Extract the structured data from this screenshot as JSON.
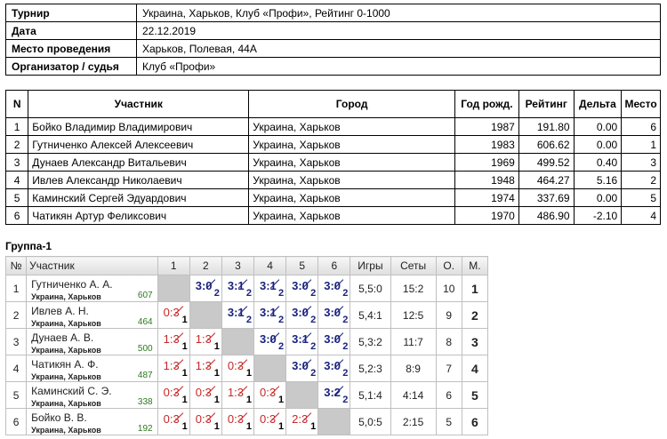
{
  "info": [
    {
      "label": "Турнир",
      "value": "Украина, Харьков, Клуб «Профи», Рейтинг 0-1000"
    },
    {
      "label": "Дата",
      "value": "22.12.2019"
    },
    {
      "label": "Место проведения",
      "value": "Харьков, Полевая, 44А"
    },
    {
      "label": "Организатор / судья",
      "value": "Клуб «Профи»"
    }
  ],
  "main": {
    "headers": {
      "n": "N",
      "player": "Участник",
      "city": "Город",
      "year": "Год рожд.",
      "rating": "Рейтинг",
      "delta": "Дельта",
      "place": "Место"
    },
    "rows": [
      {
        "n": "1",
        "player": "Бойко Владимир Владимирович",
        "city": "Украина, Харьков",
        "year": "1987",
        "rating": "191.80",
        "delta": "0.00",
        "place": "6"
      },
      {
        "n": "2",
        "player": "Гутниченко Алексей Алексеевич",
        "city": "Украина, Харьков",
        "year": "1983",
        "rating": "606.62",
        "delta": "0.00",
        "place": "1"
      },
      {
        "n": "3",
        "player": "Дунаев Александр Витальевич",
        "city": "Украина, Харьков",
        "year": "1969",
        "rating": "499.52",
        "delta": "0.40",
        "place": "3"
      },
      {
        "n": "4",
        "player": "Ивлев Александр Николаевич",
        "city": "Украина, Харьков",
        "year": "1948",
        "rating": "464.27",
        "delta": "5.16",
        "place": "2"
      },
      {
        "n": "5",
        "player": "Каминский Сергей Эдуардович",
        "city": "Украина, Харьков",
        "year": "1974",
        "rating": "337.69",
        "delta": "0.00",
        "place": "5"
      },
      {
        "n": "6",
        "player": "Чатикян Артур Феликсович",
        "city": "Украина, Харьков",
        "year": "1970",
        "rating": "486.90",
        "delta": "-2.10",
        "place": "4"
      }
    ]
  },
  "group": {
    "title": "Группа-1",
    "headers": {
      "n": "№",
      "player": "Участник",
      "c1": "1",
      "c2": "2",
      "c3": "3",
      "c4": "4",
      "c5": "5",
      "c6": "6",
      "games": "Игры",
      "sets": "Сеты",
      "points": "О.",
      "place": "М."
    },
    "rows": [
      {
        "n": "1",
        "name": "Гутниченко А. А.",
        "city": "Украина, Харьков",
        "rating": "607",
        "cells": [
          null,
          {
            "s": "3:0",
            "p": "2",
            "w": true
          },
          {
            "s": "3:1",
            "p": "2",
            "w": true
          },
          {
            "s": "3:1",
            "p": "2",
            "w": true
          },
          {
            "s": "3:0",
            "p": "2",
            "w": true
          },
          {
            "s": "3:0",
            "p": "2",
            "w": true
          }
        ],
        "games": "5,5:0",
        "sets": "15:2",
        "points": "10",
        "place": "1"
      },
      {
        "n": "2",
        "name": "Ивлев А. Н.",
        "city": "Украина, Харьков",
        "rating": "464",
        "cells": [
          {
            "s": "0:3",
            "p": "1",
            "w": false
          },
          null,
          {
            "s": "3:1",
            "p": "2",
            "w": true
          },
          {
            "s": "3:1",
            "p": "2",
            "w": true
          },
          {
            "s": "3:0",
            "p": "2",
            "w": true
          },
          {
            "s": "3:0",
            "p": "2",
            "w": true
          }
        ],
        "games": "5,4:1",
        "sets": "12:5",
        "points": "9",
        "place": "2"
      },
      {
        "n": "3",
        "name": "Дунаев А. В.",
        "city": "Украина, Харьков",
        "rating": "500",
        "cells": [
          {
            "s": "1:3",
            "p": "1",
            "w": false
          },
          {
            "s": "1:3",
            "p": "1",
            "w": false
          },
          null,
          {
            "s": "3:0",
            "p": "2",
            "w": true
          },
          {
            "s": "3:1",
            "p": "2",
            "w": true
          },
          {
            "s": "3:0",
            "p": "2",
            "w": true
          }
        ],
        "games": "5,3:2",
        "sets": "11:7",
        "points": "8",
        "place": "3"
      },
      {
        "n": "4",
        "name": "Чатикян А. Ф.",
        "city": "Украина, Харьков",
        "rating": "487",
        "cells": [
          {
            "s": "1:3",
            "p": "1",
            "w": false
          },
          {
            "s": "1:3",
            "p": "1",
            "w": false
          },
          {
            "s": "0:3",
            "p": "1",
            "w": false
          },
          null,
          {
            "s": "3:0",
            "p": "2",
            "w": true
          },
          {
            "s": "3:0",
            "p": "2",
            "w": true
          }
        ],
        "games": "5,2:3",
        "sets": "8:9",
        "points": "7",
        "place": "4"
      },
      {
        "n": "5",
        "name": "Каминский С. Э.",
        "city": "Украина, Харьков",
        "rating": "338",
        "cells": [
          {
            "s": "0:3",
            "p": "1",
            "w": false
          },
          {
            "s": "0:3",
            "p": "1",
            "w": false
          },
          {
            "s": "1:3",
            "p": "1",
            "w": false
          },
          {
            "s": "0:3",
            "p": "1",
            "w": false
          },
          null,
          {
            "s": "3:2",
            "p": "2",
            "w": true
          }
        ],
        "games": "5,1:4",
        "sets": "4:14",
        "points": "6",
        "place": "5"
      },
      {
        "n": "6",
        "name": "Бойко В. В.",
        "city": "Украина, Харьков",
        "rating": "192",
        "cells": [
          {
            "s": "0:3",
            "p": "1",
            "w": false
          },
          {
            "s": "0:3",
            "p": "1",
            "w": false
          },
          {
            "s": "0:3",
            "p": "1",
            "w": false
          },
          {
            "s": "0:3",
            "p": "1",
            "w": false
          },
          {
            "s": "2:3",
            "p": "1",
            "w": false
          },
          null
        ],
        "games": "5,0:5",
        "sets": "2:15",
        "points": "5",
        "place": "6"
      }
    ]
  }
}
